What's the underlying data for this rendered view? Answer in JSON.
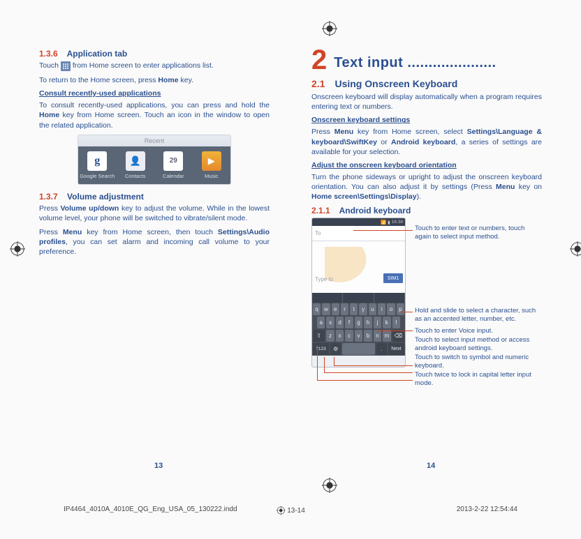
{
  "left": {
    "s136_num": "1.3.6",
    "s136_title": "Application tab",
    "s136_p1a": "Touch ",
    "s136_p1b": " from Home screen to enter applications list.",
    "s136_p2": "To return to the Home screen, press",
    "s136_p2_bold": "Home",
    "s136_p2_end": " key.",
    "consult_head": "Consult recently-used applications",
    "consult_p_a": "To consult recently-used applications, you can press and hold the ",
    "consult_p_bold": "Home",
    "consult_p_b": " key from Home screen. Touch an icon in the window to open the related application.",
    "recent_label": "Recent",
    "recents": [
      "Google Search",
      "Contacts",
      "Calendar",
      "Music"
    ],
    "cal_num": "29",
    "s137_num": "1.3.7",
    "s137_title": "Volume adjustment",
    "s137_p1_a": "Press ",
    "s137_p1_bold": "Volume up/down",
    "s137_p1_b": " key to adjust the volume. While in the lowest volume level, your phone will be switched to vibrate/silent mode.",
    "s137_p2_a": "Press ",
    "s137_p2_bold1": "Menu",
    "s137_p2_b": " key from Home screen, then touch ",
    "s137_p2_bold2": "Settings\\Audio profiles",
    "s137_p2_c": ", you can set alarm and incoming call volume to your preference."
  },
  "right": {
    "chap_num": "2",
    "chap_title": "Text input .....................",
    "s21_num": "2.1",
    "s21_title": "Using Onscreen Keyboard",
    "s21_p": "Onscreen keyboard will display automatically when a program requires entering text or numbers.",
    "osk_head": "Onscreen keyboard settings",
    "osk_p_a": "Press ",
    "osk_p_bold1": "Menu",
    "osk_p_b": " key from Home screen, select ",
    "osk_p_bold2": "Settings\\Language & keyboard\\SwiftKey",
    "osk_p_c": " or ",
    "osk_p_bold3": "Android keyboard",
    "osk_p_d": ", a series of settings are available for your selection.",
    "orient_head": "Adjust the onscreen keyboard orientation",
    "orient_p_a": "Turn the phone sideways or upright to adjust the onscreen keyboard orientation. You can also adjust it by settings (Press ",
    "orient_p_bold1": "Menu",
    "orient_p_b": " key on ",
    "orient_p_bold2": "Home screen\\Settings\\Display",
    "orient_p_c": ").",
    "s211_num": "2.1.1",
    "s211_title": "Android keyboard",
    "status_time": "16:38",
    "to_field": "To",
    "type_hint": "Type to",
    "sim_tab": "SIM1",
    "row1": [
      "q",
      "w",
      "e",
      "r",
      "t",
      "y",
      "u",
      "i",
      "o",
      "p"
    ],
    "row2": [
      "a",
      "s",
      "d",
      "f",
      "g",
      "h",
      "j",
      "k",
      "l"
    ],
    "row3_shift": "⇧",
    "row3": [
      "z",
      "x",
      "c",
      "v",
      "b",
      "n",
      "m"
    ],
    "row3_del": "⌫",
    "row4": [
      "?123",
      "⚙",
      "",
      "",
      "Next"
    ],
    "callouts": {
      "c1": "Touch to enter text or numbers, touch again to select input method.",
      "c2": "Hold and slide to select a character, such as an accented letter, number, etc.",
      "c3": "Touch to enter Voice input.",
      "c4": "Touch to select input method or access android keyboard settings.",
      "c5": "Touch to switch to symbol and numeric keyboard.",
      "c6": "Touch twice to lock in capital letter input mode."
    }
  },
  "page_left": "13",
  "page_right": "14",
  "footer_file": "IP4464_4010A_4010E_QG_Eng_USA_05_130222.indd",
  "footer_mid": "13-14",
  "footer_date": "2013-2-22   12:54:44"
}
